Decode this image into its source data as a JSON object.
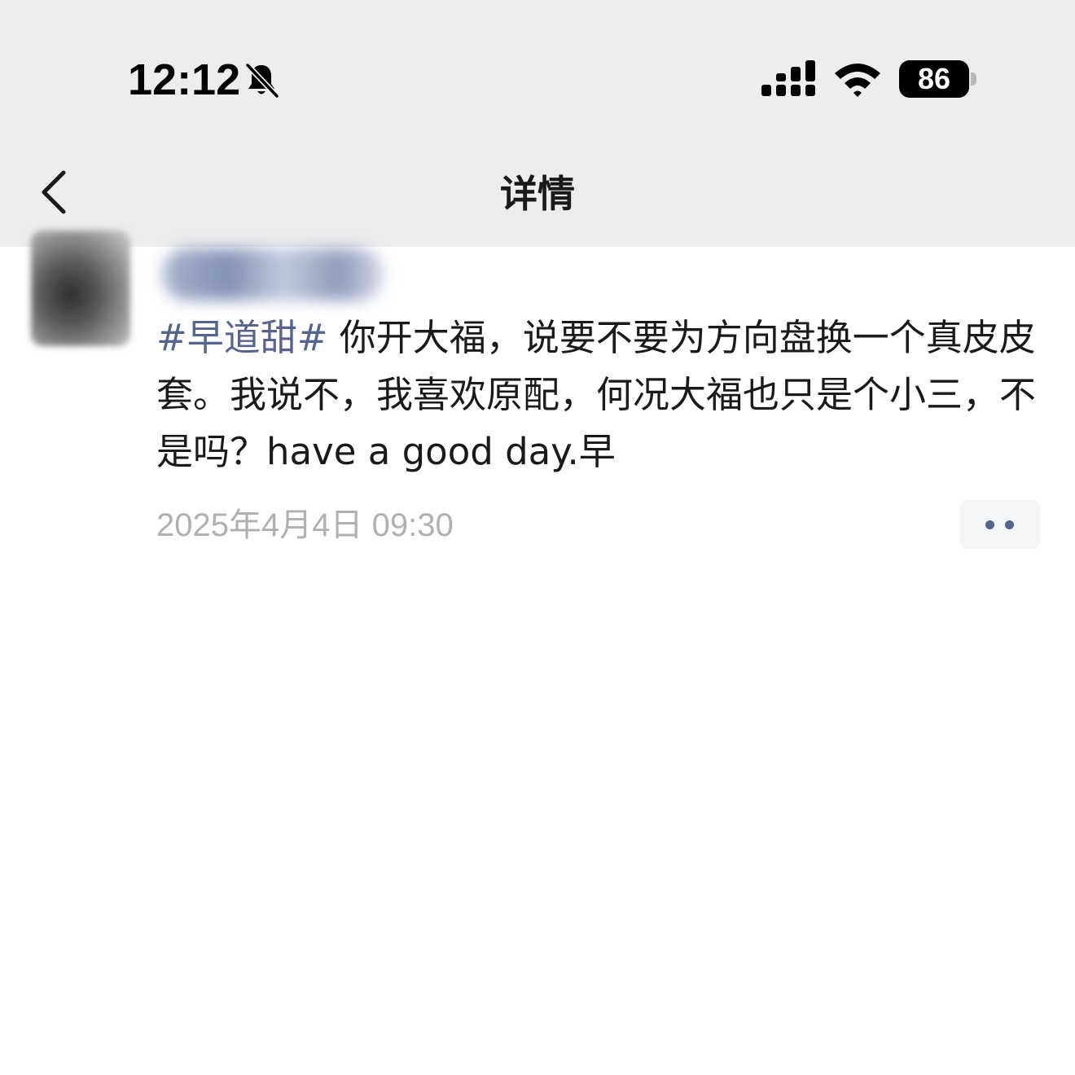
{
  "status_bar": {
    "time": "12:12",
    "icons": [
      "bell-slash-icon",
      "cellular-signal-icon",
      "wifi-icon",
      "battery-icon"
    ],
    "battery_level": "86"
  },
  "nav": {
    "back_icon": "chevron-left-icon",
    "title": "详情"
  },
  "post": {
    "hashtag": "#早道甜#",
    "text": " 你开大福，说要不要为方向盘换一个真皮皮套。我说不，我喜欢原配，何况大福也只是个小三，不是吗？have a good day.早",
    "timestamp": "2025年4月4日 09:30",
    "more_icon": "more-dots-icon"
  },
  "colors": {
    "header_bg": "#ededed",
    "hashtag": "#56638e",
    "timestamp": "#b0b0b0"
  }
}
